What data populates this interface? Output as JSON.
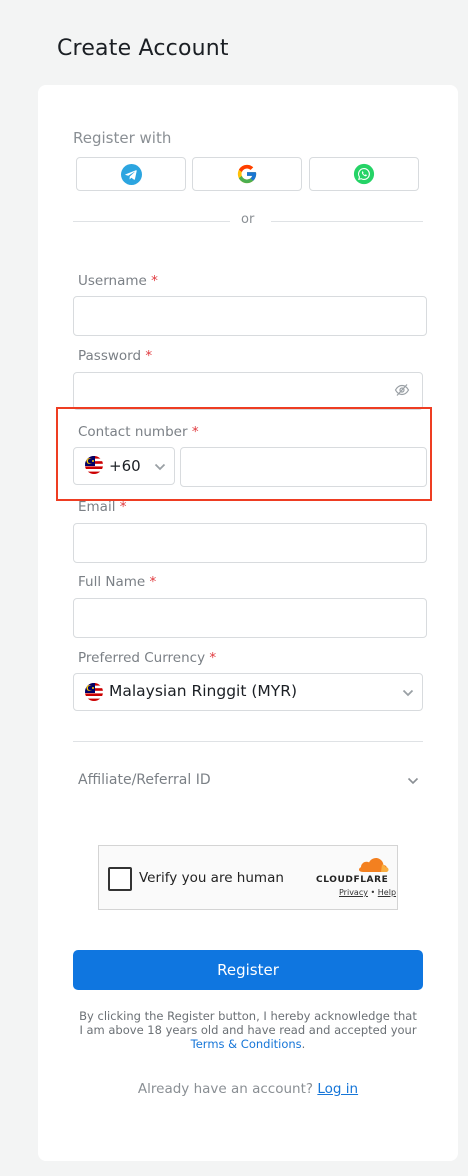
{
  "page": {
    "title": "Create Account"
  },
  "social": {
    "register_with": "Register with",
    "or": "or",
    "buttons": [
      {
        "name": "telegram",
        "icon": "telegram-icon",
        "color": "#2ca5e0"
      },
      {
        "name": "google",
        "icon": "google-icon"
      },
      {
        "name": "whatsapp",
        "icon": "whatsapp-icon",
        "color": "#25d366"
      }
    ]
  },
  "form": {
    "required_mark": "*",
    "username": {
      "label": "Username",
      "value": ""
    },
    "password": {
      "label": "Password",
      "value": "",
      "icon": "eye-slash-icon"
    },
    "contact": {
      "label": "Contact number",
      "country_code": "+60",
      "value": ""
    },
    "email": {
      "label": "Email",
      "value": ""
    },
    "full_name": {
      "label": "Full Name",
      "value": ""
    },
    "currency": {
      "label": "Preferred Currency",
      "selected": "Malaysian Ringgit (MYR)"
    },
    "affiliate": {
      "label": "Affiliate/Referral ID"
    }
  },
  "captcha": {
    "text": "Verify you are human",
    "brand": "CLOUDFLARE",
    "privacy": "Privacy",
    "dot": "•",
    "help": "Help"
  },
  "register": {
    "label": "Register"
  },
  "disclaimer": {
    "text": "By clicking the Register button, I hereby acknowledge that I am above 18 years old and have read and accepted your",
    "link": "Terms & Conditions",
    "end": "."
  },
  "login": {
    "prompt": "Already have an account?",
    "link": "Log in"
  },
  "colors": {
    "accent": "#0f76e0",
    "required": "#e0393e",
    "highlight": "#ee3d22"
  }
}
